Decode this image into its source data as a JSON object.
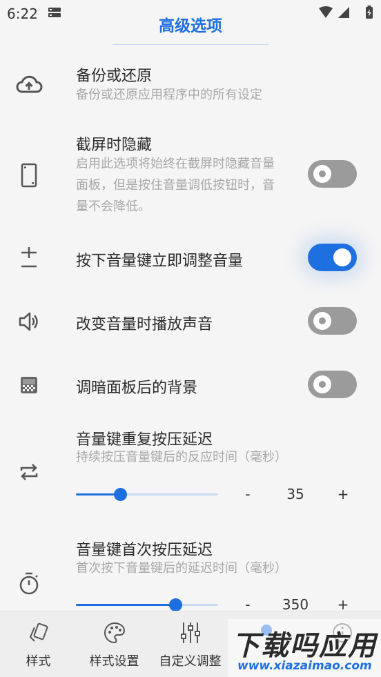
{
  "status_bar": {
    "time": "6:22"
  },
  "header": {
    "title": "高级选项"
  },
  "settings": [
    {
      "title": "备份或还原",
      "subtitle": "备份或还原应用程序中的所有设定",
      "icon": "cloud-upload-icon"
    },
    {
      "title": "截屏时隐藏",
      "subtitle": "启用此选项将始终在截屏时隐藏音量面板，但是按住音量调低按钮时，音量不会降低。",
      "icon": "phone-outline-icon",
      "toggle": "off"
    },
    {
      "title": "按下音量键立即调整音量",
      "icon": "plus-minus-icon",
      "toggle": "on"
    },
    {
      "title": "改变音量时播放声音",
      "icon": "speaker-icon",
      "toggle": "off"
    },
    {
      "title": "调暗面板后的背景",
      "icon": "checkerboard-icon",
      "toggle": "off"
    },
    {
      "title": "音量键重复按压延迟",
      "subtitle": "持续按压音量键后的反应时间（毫秒）",
      "icon": "repeat-icon",
      "slider": {
        "value": "35",
        "fraction": 0.31,
        "minus": "-",
        "plus": "+"
      }
    },
    {
      "title": "音量键首次按压延迟",
      "subtitle": "首次按下音量键后的延迟时间（毫秒）",
      "icon": "timer-icon",
      "slider": {
        "value": "350",
        "fraction": 0.7,
        "minus": "-",
        "plus": "+"
      }
    }
  ],
  "bottom_nav": [
    {
      "label": "样式",
      "icon": "cards-icon"
    },
    {
      "label": "样式设置",
      "icon": "palette-icon"
    },
    {
      "label": "自定义调整",
      "icon": "sliders-icon"
    },
    {
      "label": "",
      "icon": "advanced-icon"
    },
    {
      "label": "",
      "icon": "info-icon"
    }
  ],
  "watermark": {
    "main": "下载吗应用",
    "sub": "www.xiazaimao.com"
  },
  "colors": {
    "accent": "#1e6fe0",
    "switch_off": "#9b9b9b",
    "background": "#f5f5f5"
  }
}
